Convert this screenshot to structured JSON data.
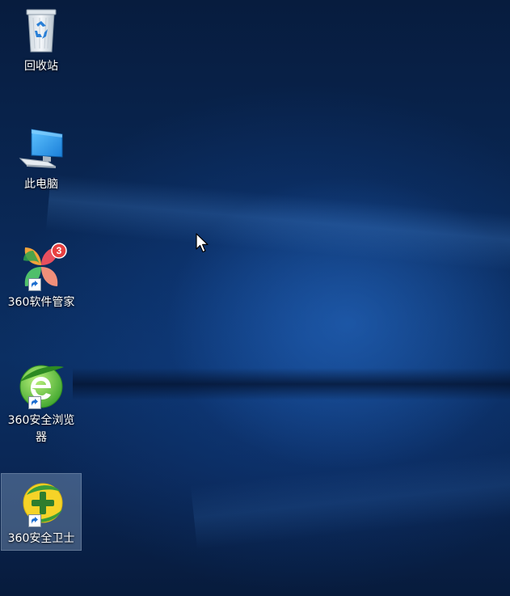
{
  "desktop": {
    "icons": [
      {
        "label": "回收站",
        "icon": "recycle-bin-icon"
      },
      {
        "label": "此电脑",
        "icon": "this-pc-icon"
      },
      {
        "label": "360软件管家",
        "icon": "360-software-manager-icon",
        "badge": "3",
        "shortcut": true
      },
      {
        "label": "360安全浏览器",
        "icon": "360-secure-browser-icon",
        "shortcut": true
      },
      {
        "label": "360安全卫士",
        "icon": "360-safe-guard-icon",
        "shortcut": true,
        "selected": true
      }
    ]
  },
  "colors": {
    "wallpaper": "#0a2a5a",
    "selection": "#a0bedc"
  }
}
